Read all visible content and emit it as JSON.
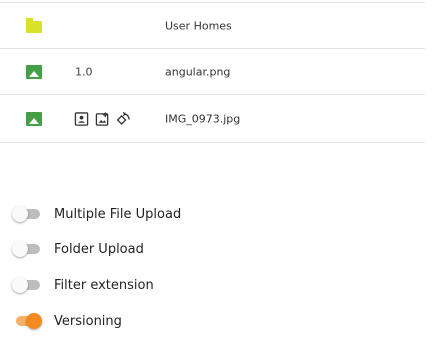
{
  "file_table": {
    "rows": [
      {
        "type_icon": "folder-icon",
        "version": "",
        "name": "User Homes"
      },
      {
        "type_icon": "image-icon",
        "version": "1.0",
        "name": "angular.png"
      },
      {
        "type_icon": "image-icon",
        "version": "",
        "name": "IMG_0973.jpg",
        "actions": [
          "portrait-icon",
          "add-photo-icon",
          "rotate-icon"
        ]
      }
    ]
  },
  "options": {
    "toggles": [
      {
        "label": "Multiple File Upload",
        "checked": false
      },
      {
        "label": "Folder Upload",
        "checked": false
      },
      {
        "label": "Filter extension",
        "checked": false
      },
      {
        "label": "Versioning",
        "checked": true
      }
    ],
    "accent_color": "#f58a1f",
    "folder_color": "#d8e22a",
    "image_color": "#43a047"
  }
}
